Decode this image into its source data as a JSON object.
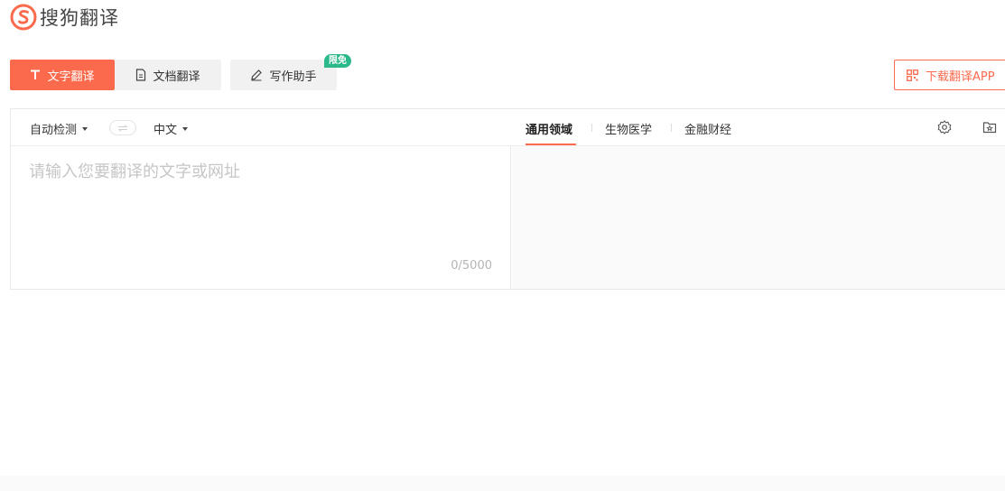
{
  "logo": {
    "text": "搜狗翻译",
    "brand_color": "#fb6a4d"
  },
  "tabs": [
    {
      "label": "文字翻译",
      "icon": "text-t-icon",
      "active": true
    },
    {
      "label": "文档翻译",
      "icon": "document-icon",
      "active": false
    },
    {
      "label": "写作助手",
      "icon": "pen-icon",
      "active": false,
      "badge": "限免"
    }
  ],
  "download": {
    "label": "下载翻译APP",
    "icon": "qrcode-icon"
  },
  "languages": {
    "source": "自动检测",
    "target": "中文",
    "swap_icon": "swap-arrows-icon"
  },
  "domains": [
    {
      "label": "通用领域",
      "active": true
    },
    {
      "label": "生物医学",
      "active": false
    },
    {
      "label": "金融财经",
      "active": false
    }
  ],
  "tools": {
    "settings_icon": "gear-icon",
    "favorite_icon": "favorite-folder-icon"
  },
  "input": {
    "placeholder": "请输入您要翻译的文字或网址",
    "value": "",
    "counter": "0/5000"
  },
  "colors": {
    "accent": "#fb6a4d",
    "badge": "#2bb88a"
  }
}
